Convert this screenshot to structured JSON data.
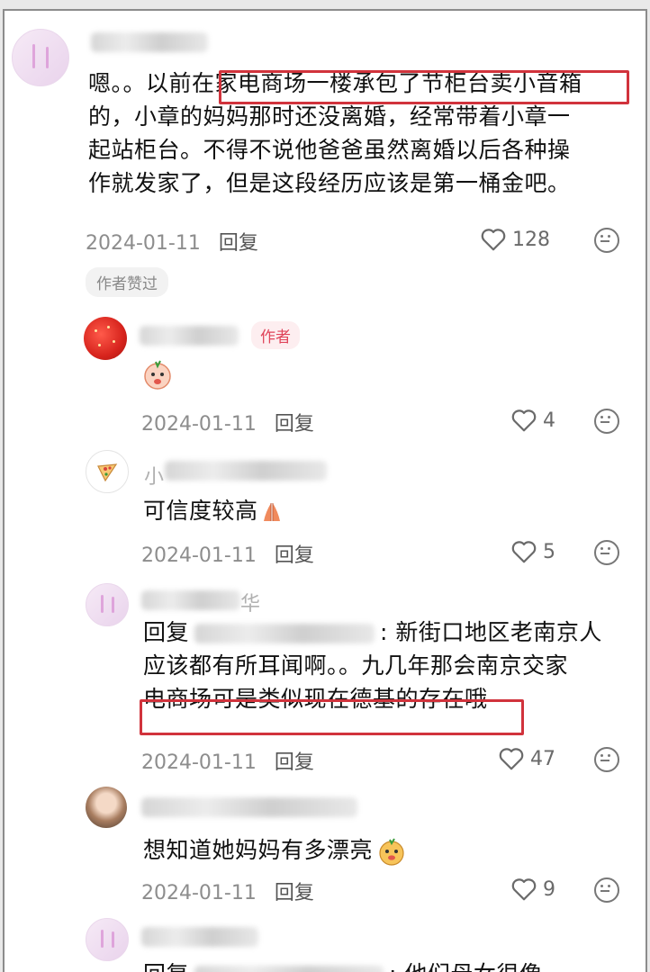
{
  "comments": [
    {
      "text_lines": [
        "嗯。。以前在家电商场一楼承包了节柜台卖小音箱",
        "的，小章的妈妈那时还没离婚，经常带着小章一",
        "起站柜台。不得不说他爸爸虽然离婚以后各种操",
        "作就发家了，但是这段经历应该是第一桶金吧。"
      ],
      "date": "2024-01-11",
      "reply_label": "回复",
      "likes": "128",
      "author_liked_badge": "作者赞过"
    },
    {
      "author_badge": "作者",
      "date": "2024-01-11",
      "reply_label": "回复",
      "likes": "4"
    },
    {
      "name_prefix": "小",
      "text": "可信度较高",
      "date": "2024-01-11",
      "reply_label": "回复",
      "likes": "5"
    },
    {
      "name_suffix": "华",
      "text_lines": [
        "回复",
        ": 新街口地区老南京人",
        "应该都有所耳闻啊。。九几年那会南京交家",
        "电商场可是类似现在德基的存在哦"
      ],
      "date": "2024-01-11",
      "reply_label": "回复",
      "likes": "47"
    },
    {
      "text": "想知道她妈妈有多漂亮",
      "date": "2024-01-11",
      "reply_label": "回复",
      "likes": "9"
    },
    {
      "text_lines": [
        "回复",
        ": 他们母女很像"
      ]
    }
  ],
  "colors": {
    "highlight_box": "#d1333c",
    "author_badge": "#e0445a",
    "meta_text": "#8d8d8d"
  },
  "icons": {
    "like": "heart-outline-icon",
    "dislike": "frown-face-icon"
  }
}
